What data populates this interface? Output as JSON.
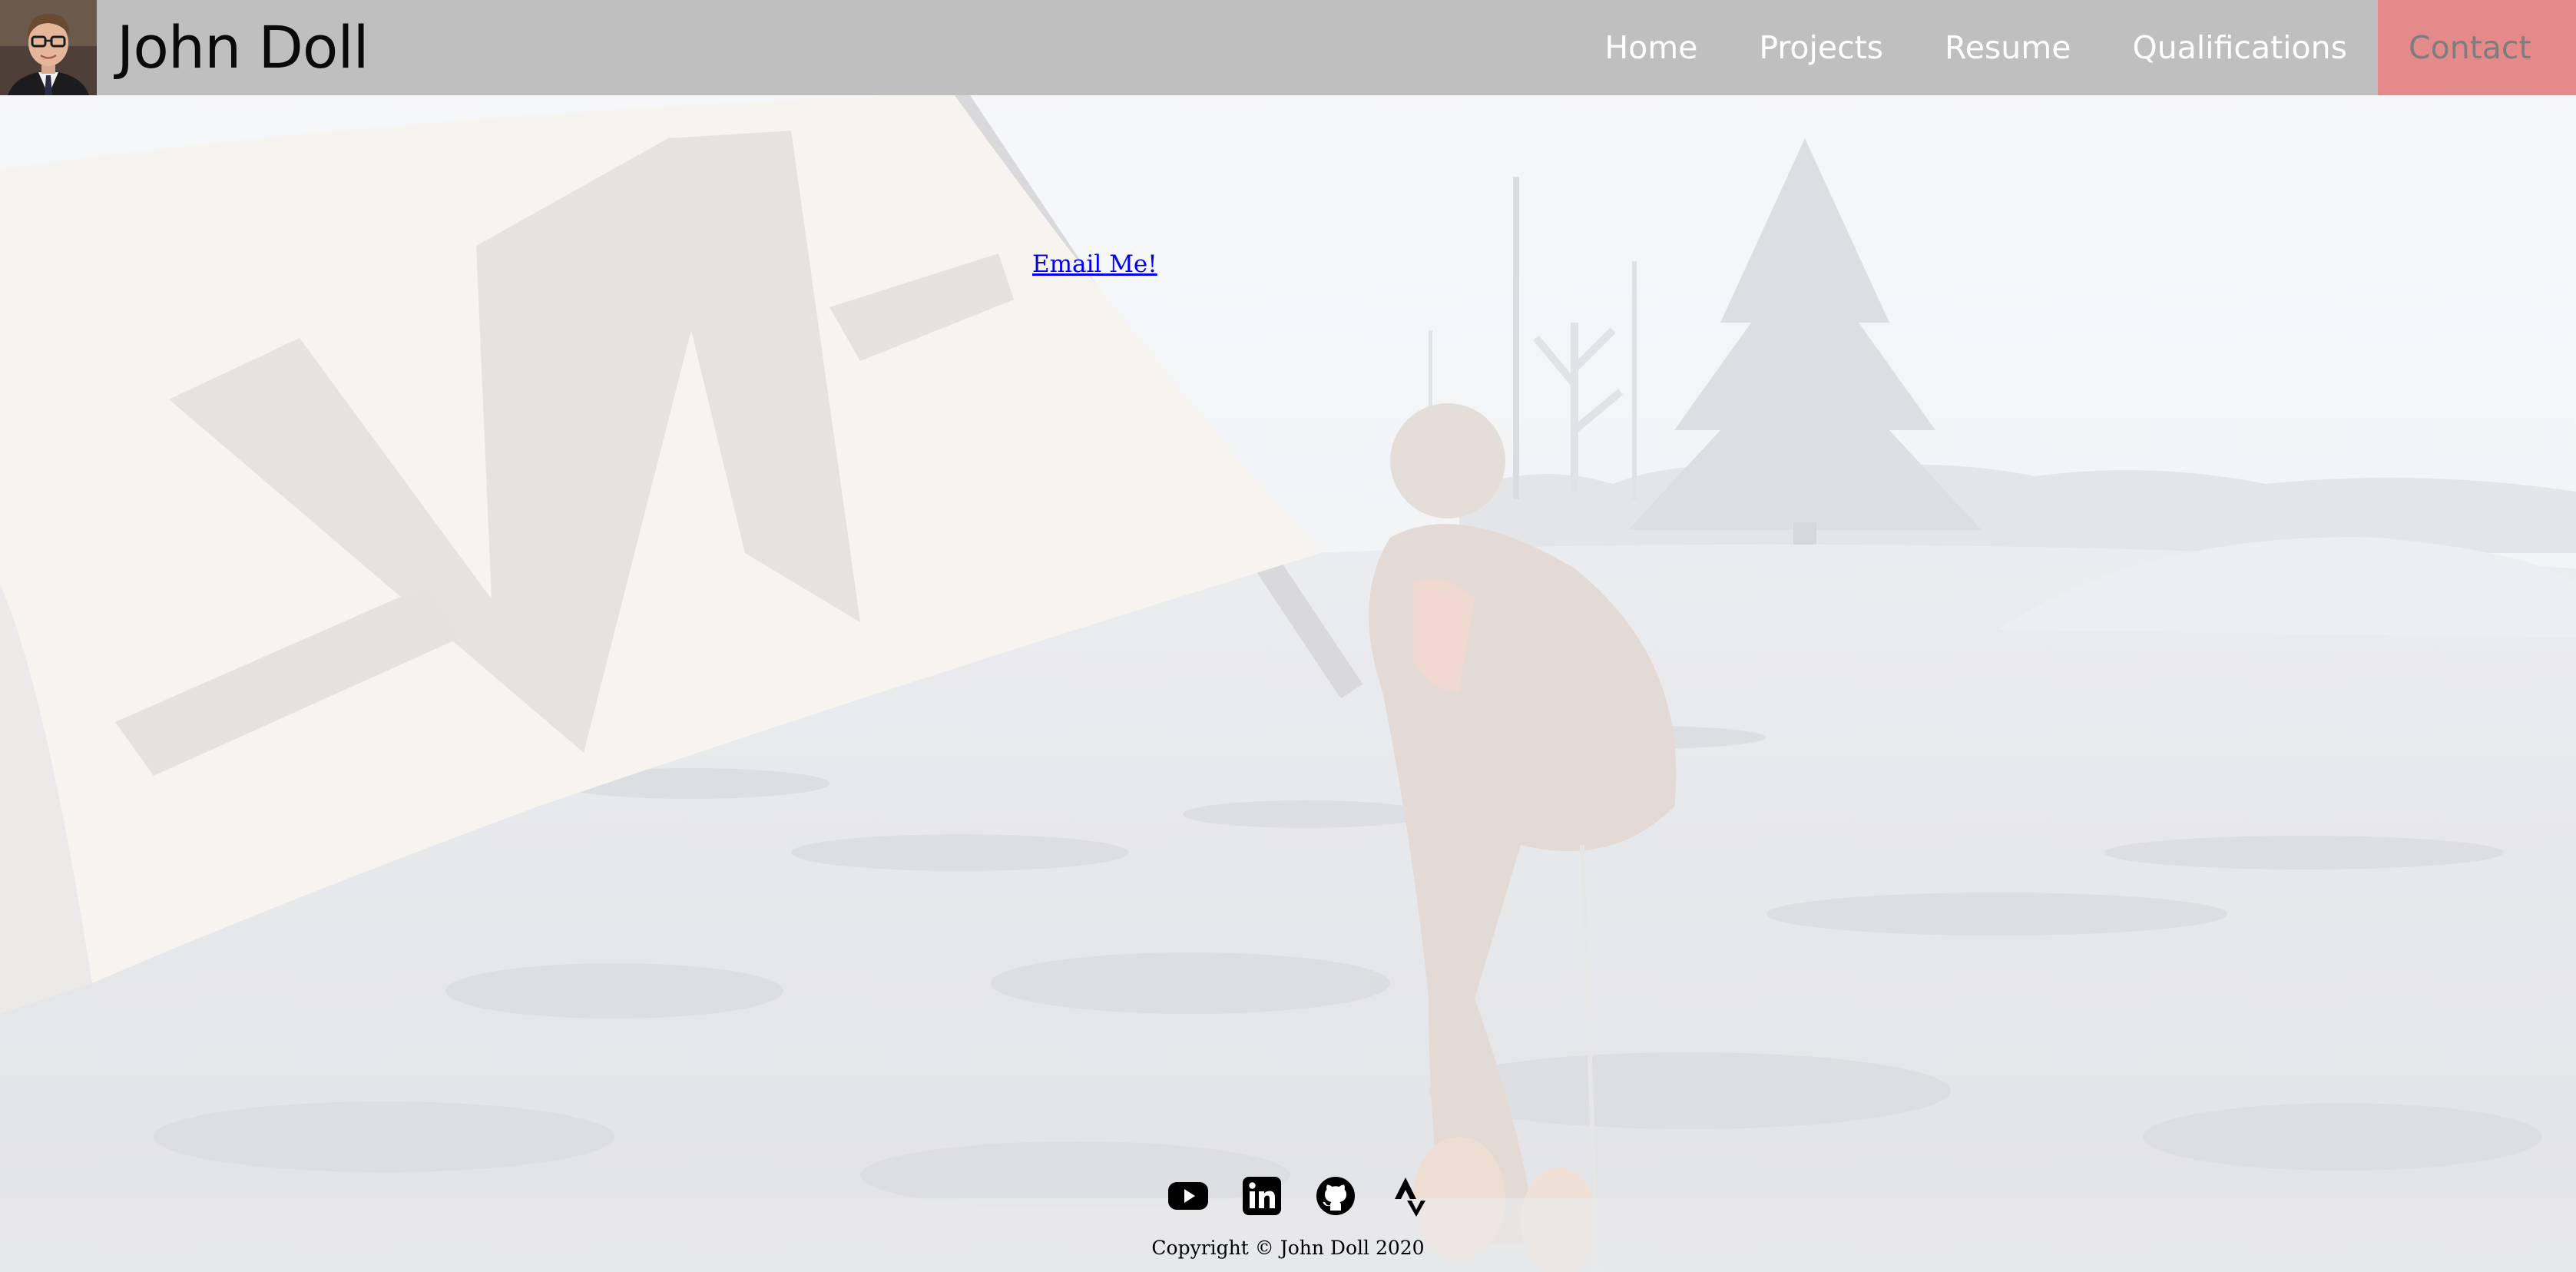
{
  "header": {
    "site_title": "John Doll",
    "avatar_alt": "John Doll headshot"
  },
  "nav": {
    "items": [
      {
        "label": "Home",
        "active": false
      },
      {
        "label": "Projects",
        "active": false
      },
      {
        "label": "Resume",
        "active": false
      },
      {
        "label": "Qualifications",
        "active": false
      },
      {
        "label": "Contact",
        "active": true
      }
    ],
    "colors": {
      "bar": "#bfbfbf",
      "active": "#e58a8a",
      "link": "#ffffff",
      "active_text": "#7d7d7d"
    }
  },
  "main": {
    "email_label": "Email Me!"
  },
  "footer": {
    "social": [
      {
        "name": "youtube-icon"
      },
      {
        "name": "linkedin-icon"
      },
      {
        "name": "github-icon"
      },
      {
        "name": "strava-icon"
      }
    ],
    "copyright": "Copyright © John Doll 2020"
  }
}
